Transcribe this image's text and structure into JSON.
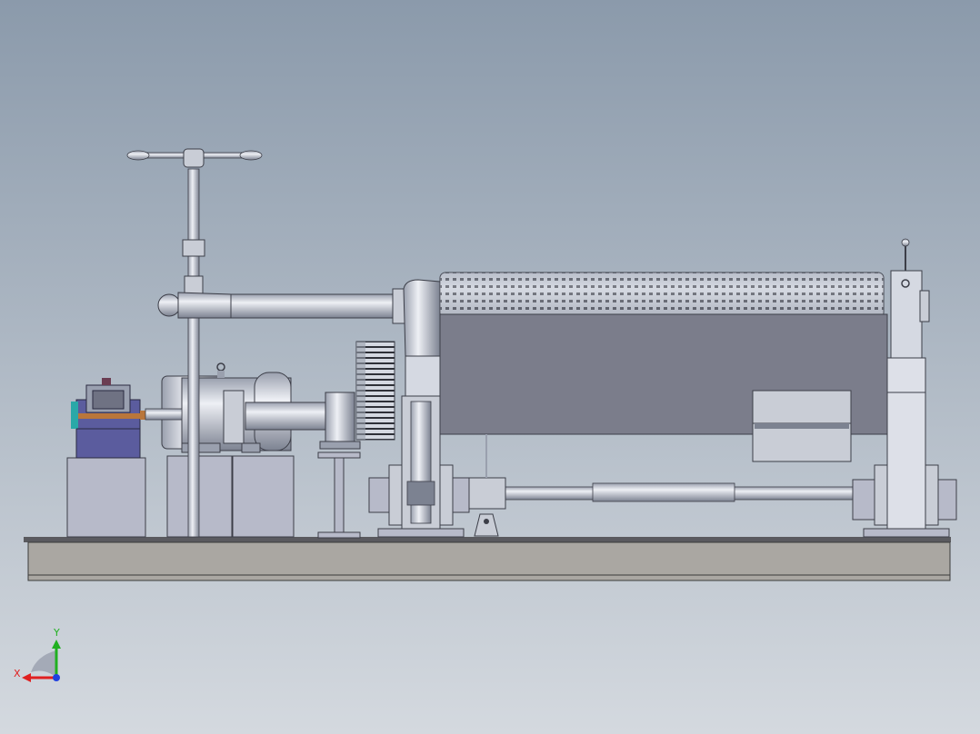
{
  "viewport": {
    "background_top": "#8b9aab",
    "background_bottom": "#d4d9df"
  },
  "colors": {
    "metal": "#b7bdc9",
    "metal_light": "#d9dde6",
    "metal_dark": "#7c8291",
    "panel": "#7b7d8b",
    "base": "#a9a6a1",
    "gearbox": "#5a5a9a",
    "axis_x": "#e02020",
    "axis_y": "#20b020",
    "axis_z": "#2040e0"
  },
  "triad": {
    "x_label": "X",
    "y_label": "Y"
  }
}
